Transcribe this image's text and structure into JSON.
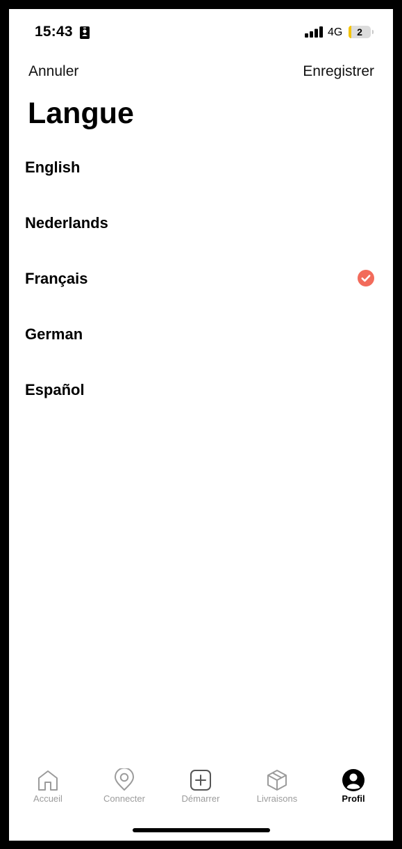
{
  "status_bar": {
    "time": "15:43",
    "network": "4G",
    "battery_level": "2",
    "id_icon": "id-card-icon",
    "signal_icon": "signal-bars-icon"
  },
  "header": {
    "cancel_label": "Annuler",
    "save_label": "Enregistrer",
    "title": "Langue"
  },
  "languages": [
    {
      "label": "English",
      "selected": false
    },
    {
      "label": "Nederlands",
      "selected": false
    },
    {
      "label": "Français",
      "selected": true
    },
    {
      "label": "German",
      "selected": false
    },
    {
      "label": "Español",
      "selected": false
    }
  ],
  "tab_bar": {
    "tabs": [
      {
        "label": "Accueil",
        "icon": "home-icon",
        "active": false
      },
      {
        "label": "Connecter",
        "icon": "location-pin-icon",
        "active": false
      },
      {
        "label": "Démarrer",
        "icon": "plus-square-icon",
        "active": false
      },
      {
        "label": "Livraisons",
        "icon": "package-icon",
        "active": false
      },
      {
        "label": "Profil",
        "icon": "profile-icon",
        "active": true
      }
    ]
  },
  "colors": {
    "accent": "#f26b5b",
    "inactive_tab": "#9b9b9b",
    "battery_low": "#f5c400"
  }
}
